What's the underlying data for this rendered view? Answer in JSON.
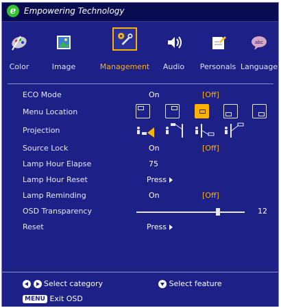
{
  "header": {
    "logo_letter": "e",
    "title": "Empowering Technology"
  },
  "tabs": [
    {
      "label": "Color",
      "icon": "palette-icon"
    },
    {
      "label": "Image",
      "icon": "image-icon"
    },
    {
      "label": "Management",
      "icon": "wrench-gear-icon",
      "active": true
    },
    {
      "label": "Audio",
      "icon": "speaker-icon"
    },
    {
      "label": "Personals",
      "icon": "personals-icon"
    },
    {
      "label": "Language",
      "icon": "speech-bubble-icon"
    }
  ],
  "settings": {
    "eco_mode": {
      "label": "ECO Mode",
      "on": "On",
      "off": "[Off]",
      "selected": "off"
    },
    "menu_location": {
      "label": "Menu Location",
      "options": 5,
      "selected_index": 2
    },
    "projection": {
      "label": "Projection"
    },
    "source_lock": {
      "label": "Source Lock",
      "on": "On",
      "off": "[Off]",
      "selected": "off"
    },
    "lamp_hour_elapse": {
      "label": "Lamp Hour Elapse",
      "value": "75"
    },
    "lamp_hour_reset": {
      "label": "Lamp Hour Reset",
      "value": "Press"
    },
    "lamp_reminding": {
      "label": "Lamp Reminding",
      "on": "On",
      "off": "[Off]",
      "selected": "off"
    },
    "osd_transparency": {
      "label": "OSD Transparency",
      "value": "12",
      "level_fraction": 0.75
    },
    "reset": {
      "label": "Reset",
      "value": "Press"
    }
  },
  "footer": {
    "select_category": "Select category",
    "select_feature": "Select feature",
    "menu_key": "MENU",
    "exit_osd": "Exit OSD"
  },
  "colors": {
    "background": "#1c2087",
    "titlebar": "#0a0c52",
    "highlight": "#ffb300",
    "text": "#e8e9f8"
  }
}
